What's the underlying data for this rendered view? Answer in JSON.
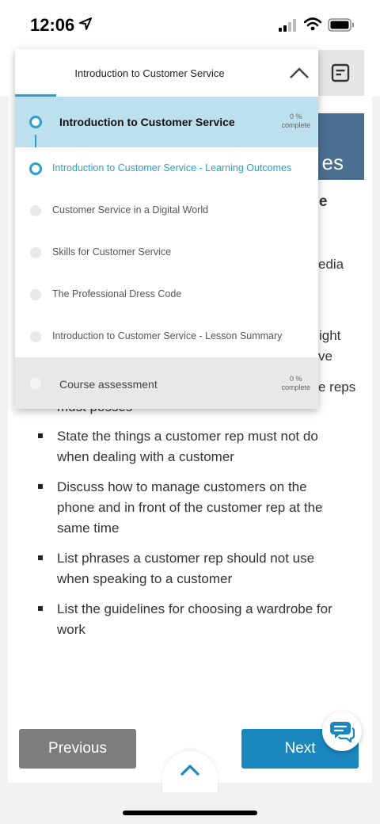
{
  "status_bar": {
    "time": "12:06"
  },
  "menu": {
    "title": "Introduction to Customer Service",
    "lesson": {
      "title": "Introduction to Customer Service",
      "progress_pct": "0 %",
      "progress_label": "complete"
    },
    "topics": [
      {
        "label": "Introduction to Customer Service - Learning Outcomes",
        "active": true
      },
      {
        "label": "Customer Service in a Digital World",
        "active": false
      },
      {
        "label": "Skills for Customer Service",
        "active": false
      },
      {
        "label": "The Professional Dress Code",
        "active": false
      },
      {
        "label": "Introduction to Customer Service - Lesson Summary",
        "active": false
      }
    ],
    "assessment": {
      "title": "Course assessment",
      "progress_pct": "0 %",
      "progress_label": "complete"
    }
  },
  "content": {
    "banner_fragment": "es",
    "heading_fragment": "ple",
    "text_fragments": [
      "edia",
      "ight",
      "ve",
      "e reps"
    ],
    "partial_line": "must posses",
    "bullets": [
      "State the things a customer rep must not do when dealing with a customer",
      "Discuss how to manage customers on the phone and in front of the customer rep at the same time",
      "List phrases a customer rep should not use when speaking to a customer",
      "List the guidelines for choosing a wardrobe for work"
    ]
  },
  "nav": {
    "previous_label": "Previous",
    "next_label": "Next"
  },
  "colors": {
    "accent": "#2a9fd0",
    "next_button": "#1a87bf",
    "previous_button": "#7d7d7d",
    "active_row": "#bde0ee",
    "banner": "#4a6f91"
  }
}
